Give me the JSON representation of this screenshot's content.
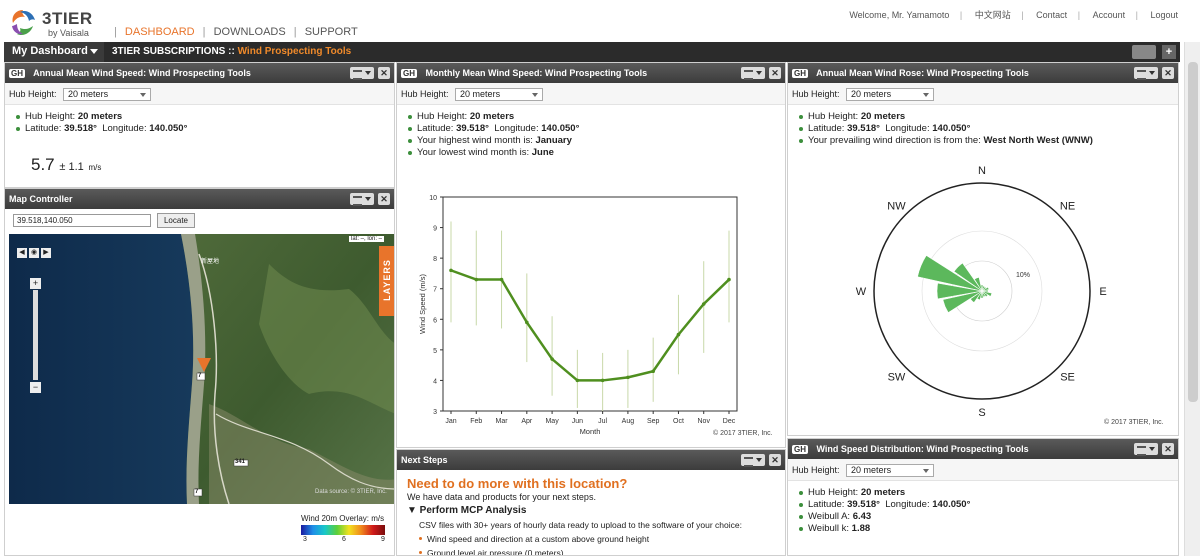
{
  "brand": {
    "name": "3TIER",
    "sub": "by Vaisala"
  },
  "nav": {
    "dashboard": "DASHBOARD",
    "downloads": "DOWNLOADS",
    "support": "SUPPORT",
    "sep": "|"
  },
  "user_nav": {
    "welcome": "Welcome, Mr. Yamamoto",
    "chinese": "中文网站",
    "contact": "Contact",
    "account": "Account",
    "logout": "Logout",
    "sep": "|"
  },
  "dashbar": {
    "selector": "My Dashboard",
    "title_prefix": "3TIER SUBSCRIPTIONS ::",
    "title_accent": "Wind Prospecting Tools",
    "add": "+"
  },
  "panels": {
    "annual_mean": {
      "title": "Annual Mean Wind Speed: Wind Prospecting Tools",
      "hub_label": "Hub Height:",
      "hub_value": "20 meters",
      "hub_height_label": "Hub Height:",
      "hub_height": "20 meters",
      "lat_label": "Latitude:",
      "lat": "39.518°",
      "lon_label": "Longitude:",
      "lon": "140.050°",
      "speed": "5.7",
      "pm": "± 1.1",
      "unit": "m/s"
    },
    "map": {
      "title": "Map Controller",
      "coord_input": "39.518,140.050",
      "locate": "Locate",
      "latlon_readout": "lat: –, lon: –",
      "layers": "LAYERS",
      "town": "新屋地",
      "road1": "7",
      "road2": "7",
      "road3": "341",
      "datasource": "Data source: © 3TIER, Inc.",
      "overlay_label": "Wind 20m Overlay: m/s",
      "legend_ticks": [
        "3",
        "6",
        "9"
      ]
    },
    "monthly": {
      "title": "Monthly Mean Wind Speed: Wind Prospecting Tools",
      "hub_label": "Hub Height:",
      "hub_value": "20 meters",
      "hub_height_label": "Hub Height:",
      "hub_height": "20 meters",
      "lat_label": "Latitude:",
      "lat": "39.518°",
      "lon_label": "Longitude:",
      "lon": "140.050°",
      "highest_label": "Your highest wind month is:",
      "highest": "January",
      "lowest_label": "Your lowest wind month is:",
      "lowest": "June",
      "copyright": "© 2017 3TIER, Inc."
    },
    "wind_rose": {
      "title": "Annual Mean Wind Rose: Wind Prospecting Tools",
      "hub_label": "Hub Height:",
      "hub_value": "20 meters",
      "hub_height_label": "Hub Height:",
      "hub_height": "20 meters",
      "lat_label": "Latitude:",
      "lat": "39.518°",
      "lon_label": "Longitude:",
      "lon": "140.050°",
      "prevailing_label": "Your prevailing wind direction is from the:",
      "prevailing": "West North West (WNW)",
      "directions": [
        "N",
        "NE",
        "E",
        "SE",
        "S",
        "SW",
        "W",
        "NW"
      ],
      "ring_label": "10%",
      "petal_color": "#5cb85c",
      "copyright": "© 2017 3TIER, Inc."
    },
    "next_steps": {
      "title": "Next Steps",
      "headline": "Need to do more with this location?",
      "sub": "We have data and products for your next steps.",
      "section": "▼ Perform MCP Analysis",
      "text": "CSV files with 30+ years of hourly data ready to upload to the software of your choice:",
      "bullets": [
        "Wind speed and direction at a custom above ground height",
        "Ground level air pressure (0 meters)"
      ]
    },
    "distribution": {
      "title": "Wind Speed Distribution: Wind Prospecting Tools",
      "hub_label": "Hub Height:",
      "hub_value": "20 meters",
      "hub_height_label": "Hub Height:",
      "hub_height": "20 meters",
      "lat_label": "Latitude:",
      "lat": "39.518°",
      "lon_label": "Longitude:",
      "lon": "140.050°",
      "weibull_a_label": "Weibull A:",
      "weibull_a": "6.43",
      "weibull_k_label": "Weibull k:",
      "weibull_k": "1.88"
    }
  },
  "chart_data": {
    "type": "line",
    "categories": [
      "Jan",
      "Feb",
      "Mar",
      "Apr",
      "May",
      "Jun",
      "Jul",
      "Aug",
      "Sep",
      "Oct",
      "Nov",
      "Dec"
    ],
    "series": [
      {
        "values": [
          7.6,
          7.3,
          7.3,
          5.9,
          4.7,
          4.0,
          4.0,
          4.1,
          4.3,
          5.5,
          6.5,
          7.3
        ]
      }
    ],
    "error_low": [
      5.9,
      5.8,
      5.7,
      4.6,
      3.5,
      3.1,
      3.0,
      3.1,
      3.3,
      4.2,
      4.9,
      5.9
    ],
    "error_high": [
      9.2,
      8.9,
      8.9,
      7.5,
      6.1,
      5.0,
      4.9,
      5.0,
      5.4,
      6.8,
      7.9,
      8.9
    ],
    "xlabel": "Month",
    "ylabel": "Wind Speed (m/s)",
    "ylim": [
      3,
      10
    ],
    "yticks": [
      "3",
      "4",
      "5",
      "6",
      "7",
      "8",
      "9",
      "10"
    ],
    "line_color": "#4f8f1f",
    "error_color": "#c8d8a8"
  }
}
